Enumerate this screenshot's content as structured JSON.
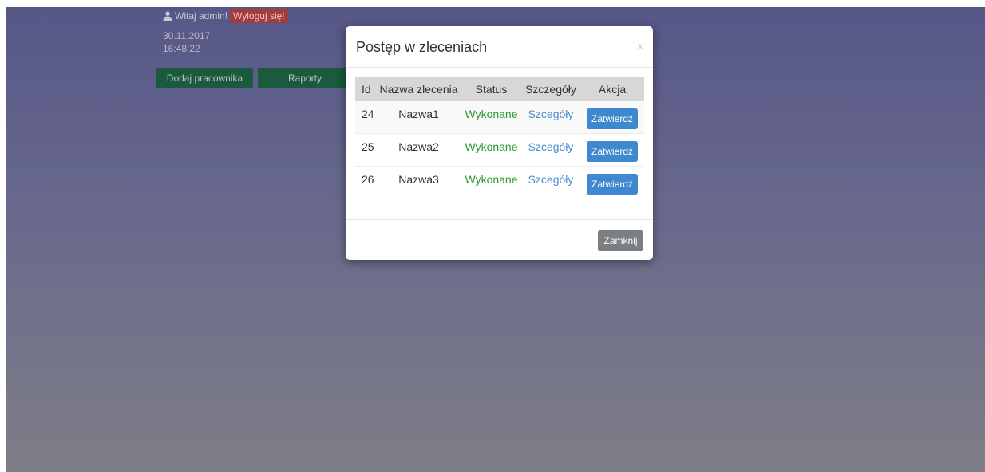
{
  "header": {
    "greeting": "Witaj admin!",
    "logout_label": "Wyloguj się!",
    "date": "30.11.2017",
    "time": "16:48:22"
  },
  "nav": {
    "add_employee_label": "Dodaj pracownika",
    "reports_label": "Raporty"
  },
  "modal": {
    "title": "Postęp w zleceniach",
    "close_symbol": "×",
    "table": {
      "headers": [
        "Id",
        "Nazwa zlecenia",
        "Status",
        "Szczegóły",
        "Akcja"
      ],
      "rows": [
        {
          "id": "24",
          "name": "Nazwa1",
          "status": "Wykonane",
          "details": "Szcegóły",
          "action": "Zatwierdź"
        },
        {
          "id": "25",
          "name": "Nazwa2",
          "status": "Wykonane",
          "details": "Szcegóły",
          "action": "Zatwierdź"
        },
        {
          "id": "26",
          "name": "Nazwa3",
          "status": "Wykonane",
          "details": "Szcegóły",
          "action": "Zatwierdź"
        }
      ]
    },
    "close_button_label": "Zamknij"
  },
  "colors": {
    "status_ok": "#2c9a2c",
    "link": "#4a8fcf",
    "primary_button": "#3d88cf",
    "close_button": "#7a7f84",
    "nav_button": "#1b5a3c",
    "logout_badge": "#a53b3b"
  },
  "icons": {
    "user": "user-icon"
  }
}
